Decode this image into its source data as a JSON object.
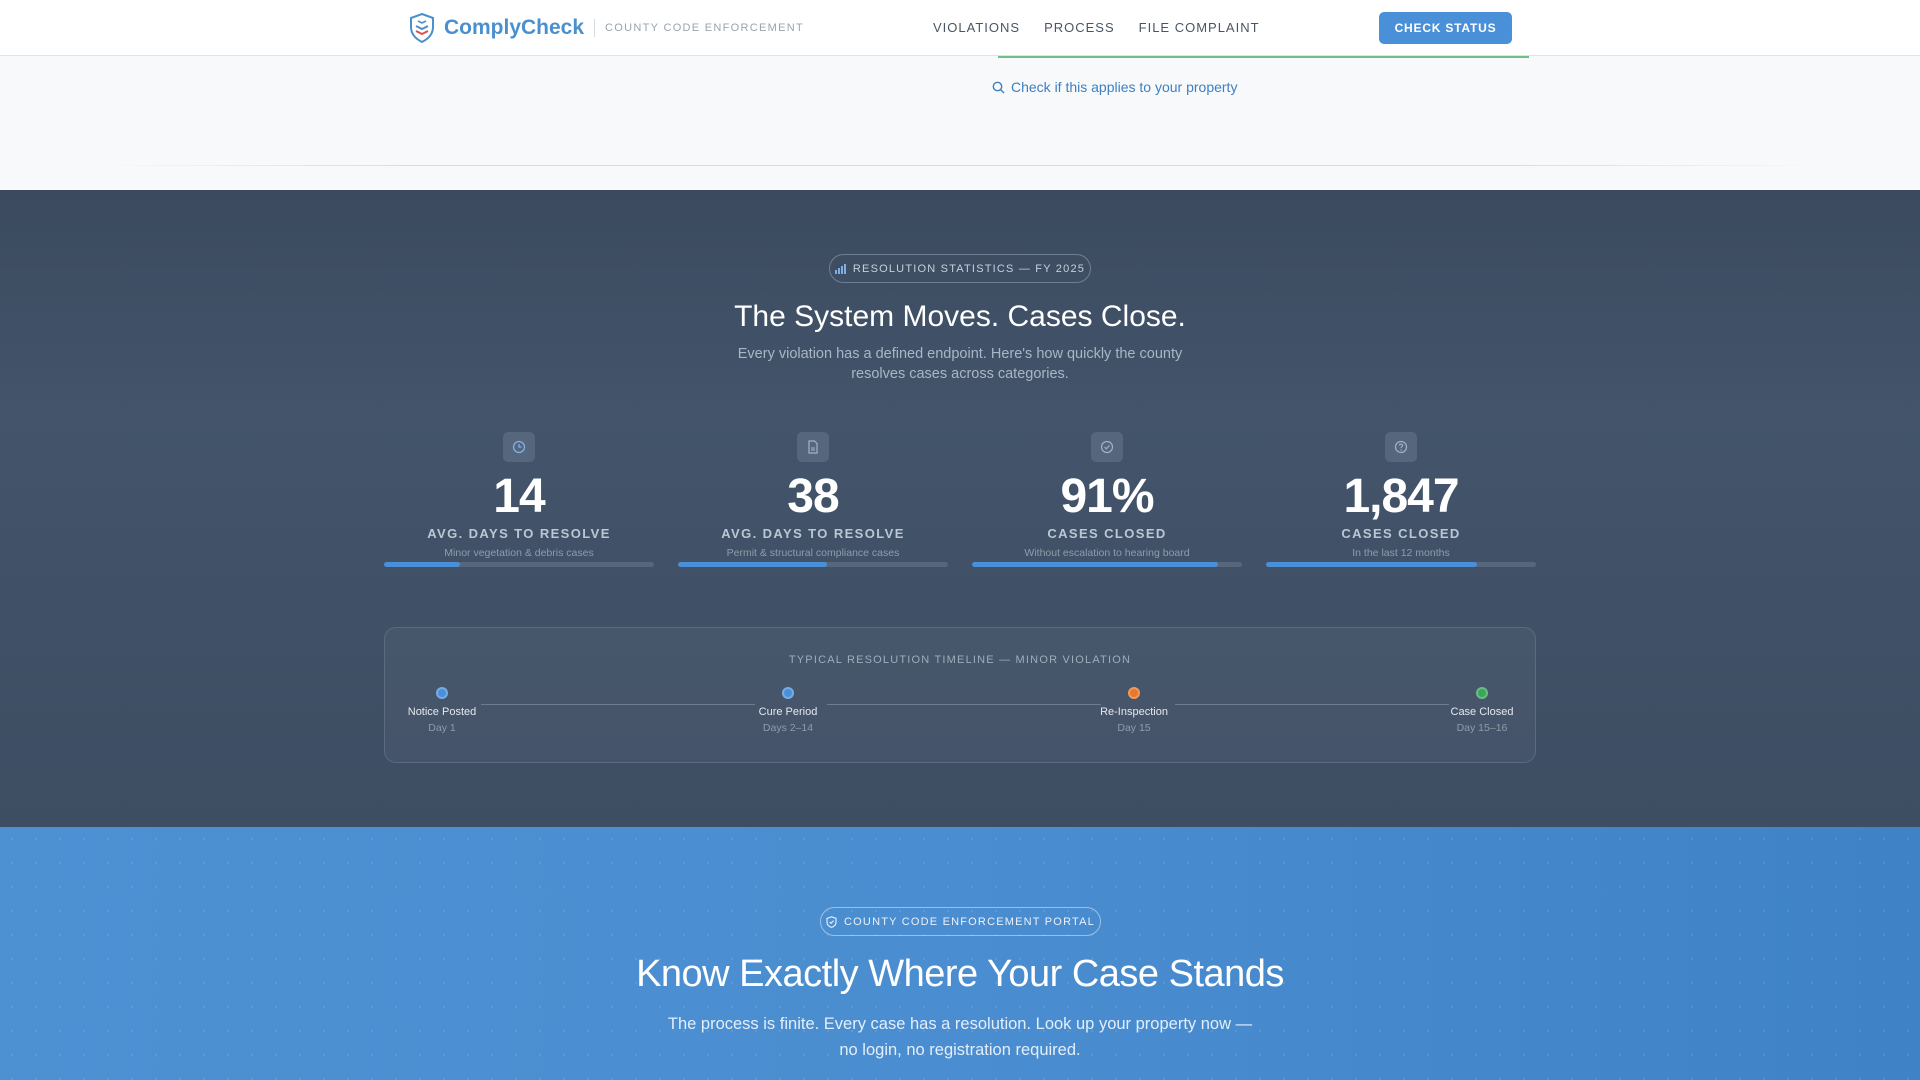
{
  "header": {
    "brand": "ComplyCheck",
    "subtitle": "COUNTY CODE ENFORCEMENT",
    "nav": [
      "VIOLATIONS",
      "PROCESS",
      "FILE COMPLAINT"
    ],
    "cta": "CHECK STATUS"
  },
  "top": {
    "applies_link": "Check if this applies to your property"
  },
  "stats": {
    "badge": "RESOLUTION STATISTICS — FY 2025",
    "title": "The System Moves. Cases Close.",
    "subtitle": "Every violation has a defined endpoint. Here's how quickly the county resolves cases across categories.",
    "cards": [
      {
        "icon": "clock-icon",
        "value": "14",
        "label": "AVG. DAYS TO RESOLVE",
        "desc": "Minor vegetation & debris cases",
        "progress": 0.28
      },
      {
        "icon": "document-icon",
        "value": "38",
        "label": "AVG. DAYS TO RESOLVE",
        "desc": "Permit & structural compliance cases",
        "progress": 0.55
      },
      {
        "icon": "check-circle-icon",
        "value": "91%",
        "label": "CASES CLOSED",
        "desc": "Without escalation to hearing board",
        "progress": 0.91
      },
      {
        "icon": "question-circle-icon",
        "value": "1,847",
        "label": "CASES CLOSED",
        "desc": "In the last 12 months",
        "progress": 0.78
      }
    ],
    "timeline": {
      "title": "TYPICAL RESOLUTION TIMELINE — MINOR VIOLATION",
      "steps": [
        {
          "name": "Notice Posted",
          "day": "Day 1",
          "color": "#4a90d9"
        },
        {
          "name": "Cure Period",
          "day": "Days 2–14",
          "color": "#4a90d9"
        },
        {
          "name": "Re-Inspection",
          "day": "Day 15",
          "color": "#e8782a"
        },
        {
          "name": "Case Closed",
          "day": "Day 15–16",
          "color": "#3aa55c"
        }
      ]
    }
  },
  "hero": {
    "badge": "COUNTY CODE ENFORCEMENT PORTAL",
    "title": "Know Exactly Where Your Case Stands",
    "subtitle": "The process is finite. Every case has a resolution. Look up your property now — no login, no registration required."
  },
  "colors": {
    "accent": "#4a90d9",
    "stats_bg": "#3d4d62",
    "hero_bg": "#4a8dd0",
    "success": "#3aa55c",
    "warning": "#e8782a"
  }
}
